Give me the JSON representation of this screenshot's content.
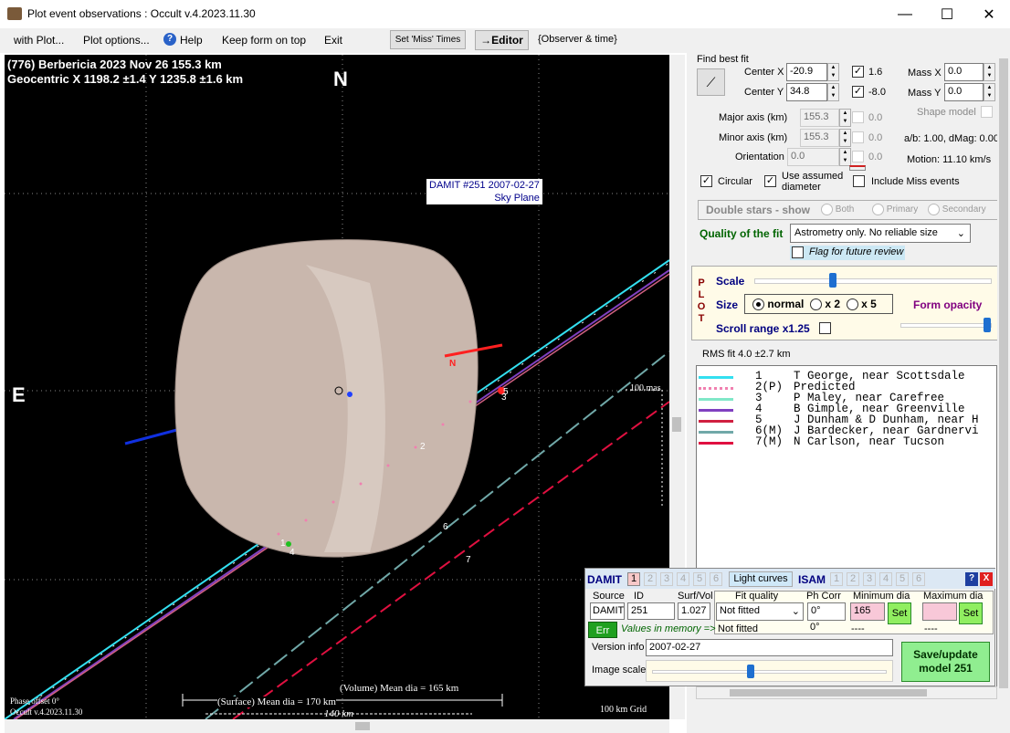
{
  "window": {
    "title": "Plot event observations : Occult v.4.2023.11.30",
    "minimize": "—",
    "maximize": "☐",
    "close": "✕"
  },
  "menu": {
    "with_plot": "with Plot...",
    "plot_options": "Plot options...",
    "help": "Help",
    "keep_form": "Keep form on top",
    "exit": "Exit",
    "set_miss": "Set 'Miss' Times",
    "editor": "→Editor",
    "observer_time": "{Observer & time}"
  },
  "plot": {
    "title_line1": "(776) Berbericia  2023 Nov 26  155.3 km",
    "title_line2": "Geocentric  X  1198.2 ±1.4  Y 1235.8 ±1.6 km",
    "north": "N",
    "east": "E",
    "model_label1": "DAMIT #251 2007-02-27",
    "model_label2": "Sky Plane",
    "scale_100mas": "100 mas",
    "volume_dia": "(Volume) Mean dia = 165 km",
    "surface_dia": "(Surface) Mean dia = 170 km",
    "km140": "140 km",
    "grid": "100 km Grid",
    "phase": "Phase offset 0°",
    "version": "Occult v.4.2023.11.30",
    "n_marker": "N"
  },
  "fit": {
    "find_best": "Find best fit",
    "center_x_label": "Center X",
    "center_x": "-20.9",
    "center_y_label": "Center Y",
    "center_y": "34.8",
    "chk1_val": "1.6",
    "chk2_val": "-8.0",
    "mass_x_label": "Mass X",
    "mass_x": "0.0",
    "mass_y_label": "Mass Y",
    "mass_y": "0.0",
    "major_label": "Major axis (km)",
    "major": "155.3",
    "minor_label": "Minor axis (km)",
    "minor": "155.3",
    "orient_label": "Orientation",
    "orient": "0.0",
    "zero": "0.0",
    "shape_model": "Shape model",
    "ab": "a/b: 1.00, dMag: 0.00",
    "motion": "Motion: 11.10 km/s",
    "circular": "Circular",
    "use_assumed": "Use assumed",
    "diameter": "diameter",
    "include_miss": "Include Miss events"
  },
  "double": {
    "title": "Double stars - show",
    "both": "Both",
    "primary": "Primary",
    "secondary": "Secondary"
  },
  "quality": {
    "label": "Quality of the fit",
    "value": "Astrometry only. No reliable size",
    "flag": "Flag for future review"
  },
  "plotpanel": {
    "letters": [
      "P",
      "L",
      "O",
      "T"
    ],
    "scale": "Scale",
    "size": "Size",
    "normal": "normal",
    "x2": "x 2",
    "x5": "x 5",
    "form_opacity": "Form opacity",
    "scroll_range": "Scroll range x1.25",
    "scale_pct": 0.33,
    "opacity_pct": 0.95
  },
  "rms": "RMS fit 4.0 ±2.7 km",
  "legend": [
    {
      "num": "1",
      "obs": "T George, near Scottsdale",
      "color": "#33e0f0"
    },
    {
      "num": "2(P)",
      "obs": "Predicted",
      "color": "#f080b0"
    },
    {
      "num": "3",
      "obs": "P Maley, near Carefree",
      "color": "#80e8c8"
    },
    {
      "num": "4",
      "obs": "B Gimple, near Greenville",
      "color": "#8040c0"
    },
    {
      "num": "5",
      "obs": "J Dunham & D Dunham, near H",
      "color": "#d02040"
    },
    {
      "num": "6(M)",
      "obs": "J Bardecker, near Gardnervi",
      "color": "#70a8a8"
    },
    {
      "num": "7(M)",
      "obs": "N Carlson, near Tucson",
      "color": "#e01040"
    }
  ],
  "damit": {
    "title": "DAMIT",
    "tabs": [
      "1",
      "2",
      "3",
      "4",
      "5",
      "6"
    ],
    "light_curves": "Light curves",
    "isam": "ISAM",
    "help": "?",
    "close": "X",
    "source_h": "Source",
    "id_h": "ID",
    "surf_h": "Surf/Vol",
    "source": "DAMIT",
    "id": "251",
    "surf": "1.027",
    "fitq_h": "Fit quality",
    "phcorr_h": "Ph Corr",
    "min_h": "Minimum dia",
    "max_h": "Maximum dia",
    "fitq": "Not fitted",
    "phcorr": "0°",
    "min": "165",
    "set": "Set",
    "err": "Err",
    "values_mem": "Values in memory =>",
    "fitq2": "Not fitted",
    "phcorr2": "0°",
    "dash": "----",
    "version_label": "Version info",
    "version": "2007-02-27",
    "image_scale": "Image scale",
    "save1": "Save/update",
    "save2": "model 251",
    "image_scale_pct": 0.42
  }
}
